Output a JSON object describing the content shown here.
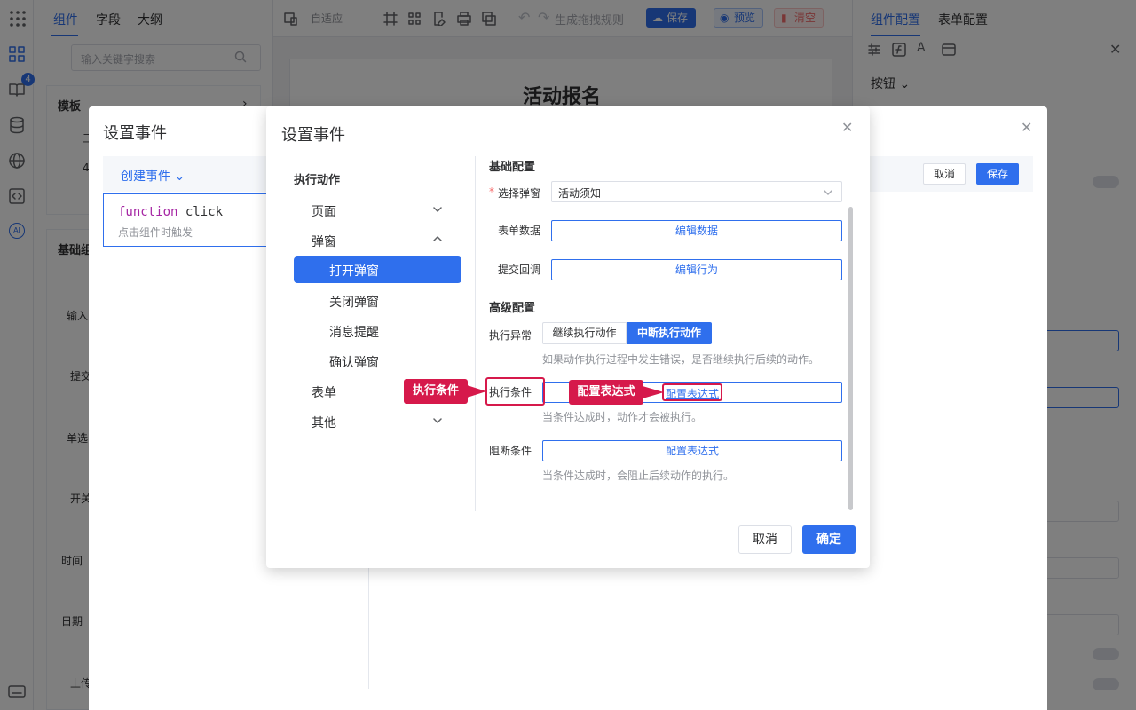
{
  "left_panel": {
    "tabs": [
      "组件",
      "字段",
      "大纲"
    ],
    "search_placeholder": "输入关键字搜索",
    "template_header": "模板",
    "template_items": [
      "三",
      "4"
    ],
    "basic_header": "基础组",
    "components": [
      "输入",
      "提交",
      "单选",
      "开关",
      "时间",
      "日期",
      "上传"
    ]
  },
  "rail": {
    "badge": "4",
    "ai_label": "AI"
  },
  "toolbar": {
    "adaptive": "自适应",
    "gen_rules": "生成拖拽规则",
    "save": "保存",
    "preview": "预览",
    "clear": "清空"
  },
  "canvas": {
    "form_title": "活动报名"
  },
  "right_panel": {
    "tabs": [
      "组件配置",
      "表单配置"
    ],
    "component_type": "按钮"
  },
  "back_modal": {
    "title": "设置事件",
    "create_event": "创建事件",
    "function_keyword": "function",
    "function_name": "click",
    "function_desc": "点击组件时触发",
    "cancel": "取消",
    "save": "保存"
  },
  "modal": {
    "title": "设置事件",
    "nav_header": "执行动作",
    "nav": {
      "page": "页面",
      "popup": "弹窗",
      "popup_items": [
        "打开弹窗",
        "关闭弹窗",
        "消息提醒",
        "确认弹窗"
      ],
      "form": "表单",
      "other": "其他"
    },
    "basic_title": "基础配置",
    "required_mark": "*",
    "select_popup_label": "选择弹窗",
    "select_popup_value": "活动须知",
    "form_data_label": "表单数据",
    "form_data_button": "编辑数据",
    "submit_callback_label": "提交回调",
    "submit_callback_button": "编辑行为",
    "advanced_title": "高级配置",
    "exception_label": "执行异常",
    "exception_options": [
      "继续执行动作",
      "中断执行动作"
    ],
    "exception_selected": "中断执行动作",
    "exception_hint": "如果动作执行过程中发生错误，是否继续执行后续的动作。",
    "condition_label": "执行条件",
    "condition_button": "配置表达式",
    "condition_hint": "当条件达成时，动作才会被执行。",
    "block_label": "阻断条件",
    "block_button": "配置表达式",
    "block_hint": "当条件达成时，会阻止后续动作的执行。",
    "cancel": "取消",
    "confirm": "确定"
  },
  "callouts": {
    "condition": "执行条件",
    "expression": "配置表达式"
  },
  "colors": {
    "primary": "#2f6fed",
    "danger": "#d6194b"
  }
}
